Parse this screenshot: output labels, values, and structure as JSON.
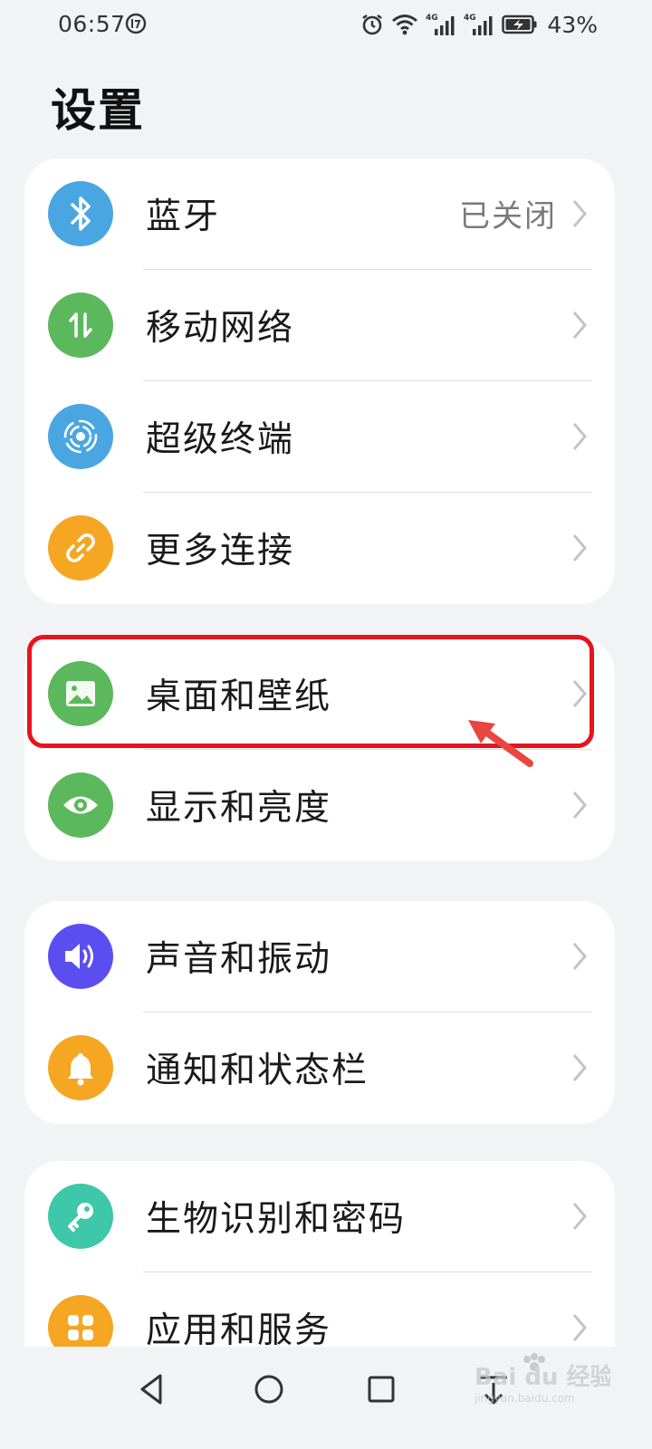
{
  "status_bar": {
    "time": "06:57",
    "battery_percent": "43%",
    "network_1": "4G",
    "network_2": "4G",
    "icons": [
      "alarm-icon",
      "wifi-icon",
      "signal-4g-icon",
      "signal-4g-icon",
      "battery-charging-icon"
    ]
  },
  "page": {
    "title": "设置"
  },
  "groups": [
    {
      "items": [
        {
          "label": "蓝牙",
          "value": "已关闭",
          "icon": "bluetooth-icon",
          "color": "#4aa6e0"
        },
        {
          "label": "移动网络",
          "icon": "mobile-network-icon",
          "color": "#5cb85c"
        },
        {
          "label": "超级终端",
          "icon": "super-device-icon",
          "color": "#4aa6e0"
        },
        {
          "label": "更多连接",
          "icon": "link-icon",
          "color": "#f5a623"
        }
      ]
    },
    {
      "items": [
        {
          "label": "桌面和壁纸",
          "icon": "wallpaper-icon",
          "color": "#5cb85c",
          "highlighted": true
        },
        {
          "label": "显示和亮度",
          "icon": "eye-icon",
          "color": "#5cb85c"
        }
      ]
    },
    {
      "items": [
        {
          "label": "声音和振动",
          "icon": "speaker-icon",
          "color": "#5b4ef0"
        },
        {
          "label": "通知和状态栏",
          "icon": "bell-icon",
          "color": "#f5a623"
        }
      ]
    },
    {
      "items": [
        {
          "label": "生物识别和密码",
          "icon": "key-icon",
          "color": "#3ec7a8"
        },
        {
          "label": "应用和服务",
          "icon": "apps-icon",
          "color": "#f5a623"
        }
      ]
    }
  ],
  "annotation": {
    "color": "#e5141e"
  },
  "nav_bar": {
    "buttons": [
      "back-icon",
      "home-icon",
      "recents-icon",
      "notification-pull-icon"
    ]
  },
  "watermark": {
    "text": "Bai du 经验",
    "sub": "jingyan.baidu.com"
  }
}
